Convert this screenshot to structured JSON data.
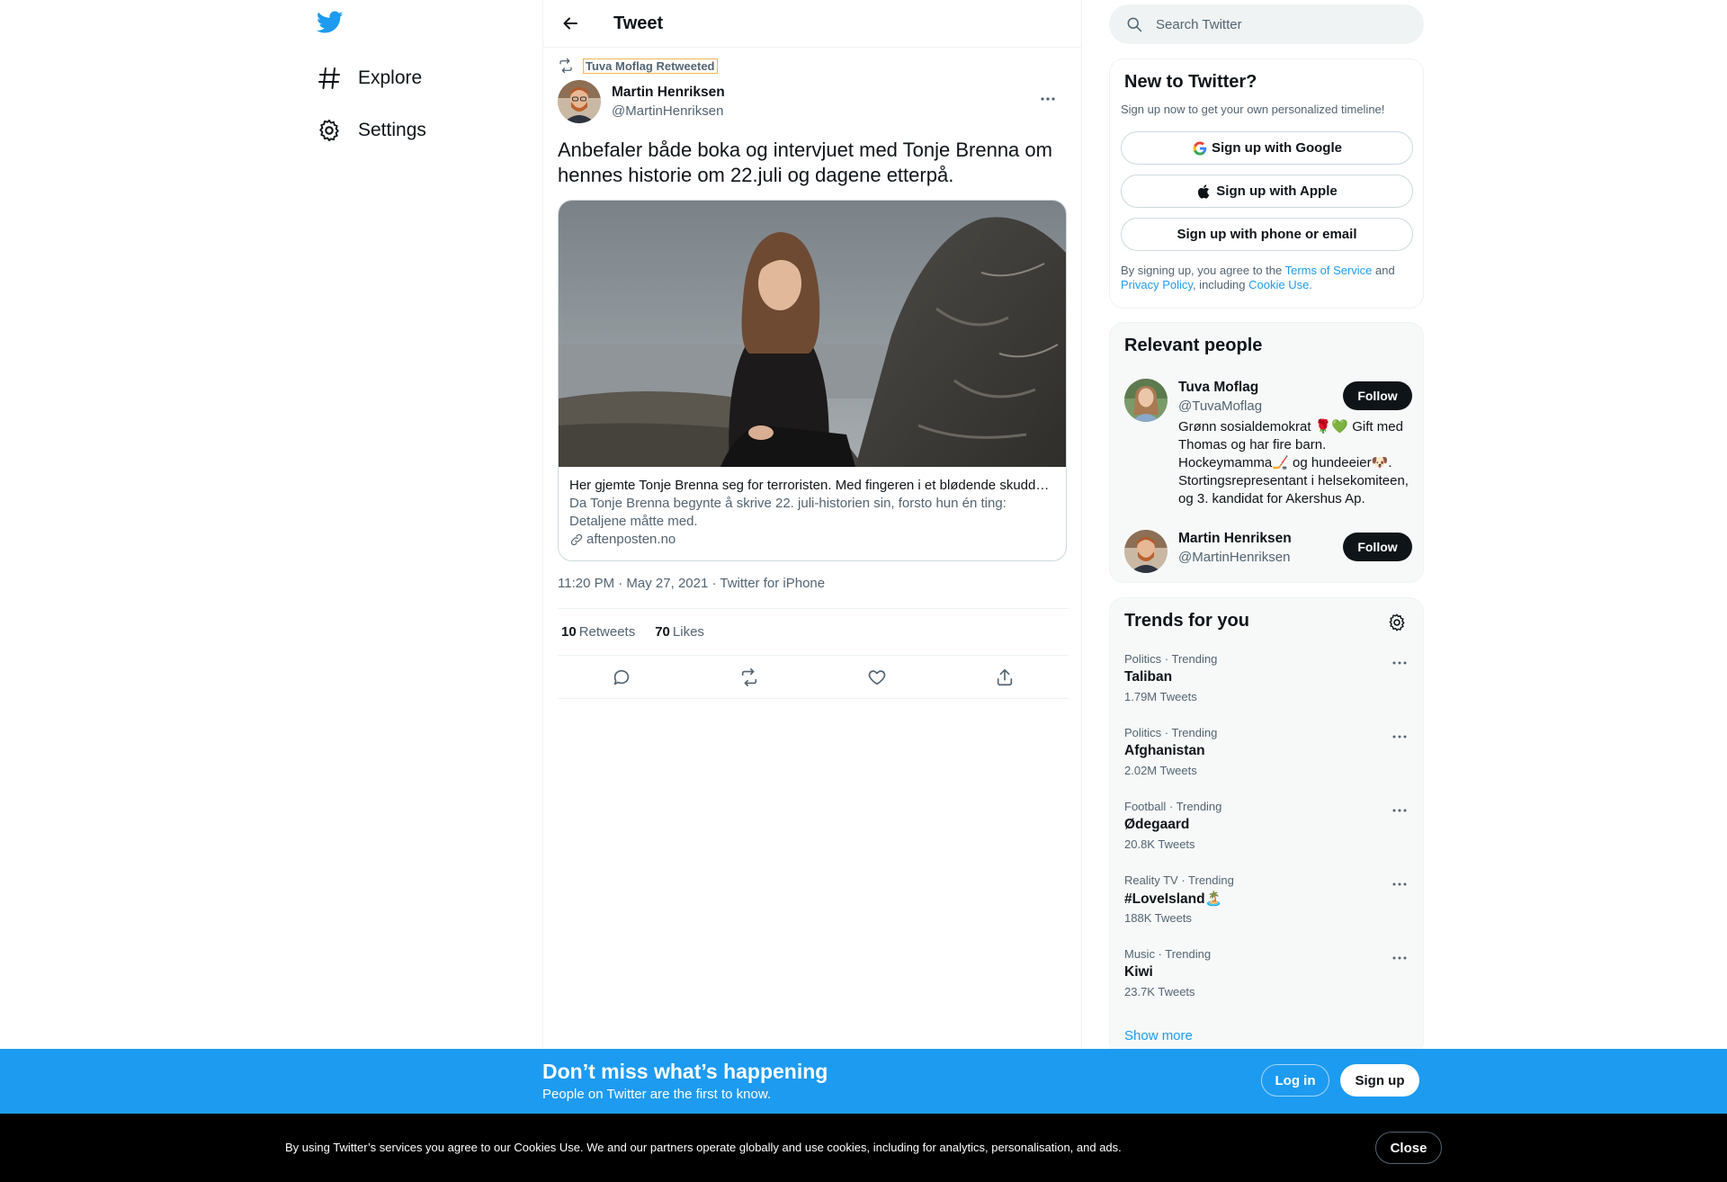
{
  "nav": {
    "items": [
      {
        "label": "Explore",
        "icon": "hashtag-icon"
      },
      {
        "label": "Settings",
        "icon": "gear-icon"
      }
    ]
  },
  "header": {
    "title": "Tweet"
  },
  "tweet": {
    "retweeted_by": "Tuva Moflag Retweeted",
    "author_name": "Martin Henriksen",
    "author_handle": "@MartinHenriksen",
    "text": "Anbefaler både boka og intervjuet med Tonje Brenna om hennes historie om 22.juli og dagene etterpå.",
    "card": {
      "title": "Her gjemte Tonje Brenna seg for terroristen. Med fingeren i et blødende skuddsår skrev hun et oppsiktsvekkende brev.",
      "description": "Da Tonje Brenna begynte å skrive 22. juli-historien sin, forsto hun én ting: Detaljene måtte med.",
      "domain": "aftenposten.no"
    },
    "meta": "11:20 PM · May 27, 2021 · Twitter for iPhone",
    "retweets_count": "10",
    "retweets_label": "Retweets",
    "likes_count": "70",
    "likes_label": "Likes"
  },
  "search": {
    "placeholder": "Search Twitter"
  },
  "new_to_twitter": {
    "title": "New to Twitter?",
    "subtitle": "Sign up now to get your own personalized timeline!",
    "google": "Sign up with Google",
    "apple": "Sign up with Apple",
    "phone": "Sign up with phone or email",
    "legal_1": "By signing up, you agree to the ",
    "terms": "Terms of Service",
    "legal_2": " and ",
    "privacy": "Privacy Policy",
    "legal_3": ", including ",
    "cookie": "Cookie Use."
  },
  "relevant": {
    "title": "Relevant people",
    "people": [
      {
        "name": "Tuva Moflag",
        "handle": "@TuvaMoflag",
        "bio": "Grønn sosialdemokrat 🌹💚 Gift med Thomas og har fire barn. Hockeymamma🏒 og hundeeier🐶. Stortingsrepresentant i helsekomiteen, og 3. kandidat for Akershus Ap.",
        "follow": "Follow"
      },
      {
        "name": "Martin Henriksen",
        "handle": "@MartinHenriksen",
        "bio": "",
        "follow": "Follow"
      }
    ]
  },
  "trends": {
    "title": "Trends for you",
    "items": [
      {
        "category": "Politics · Trending",
        "name": "Taliban",
        "count": "1.79M Tweets"
      },
      {
        "category": "Politics · Trending",
        "name": "Afghanistan",
        "count": "2.02M Tweets"
      },
      {
        "category": "Football · Trending",
        "name": "Ødegaard",
        "count": "20.8K Tweets"
      },
      {
        "category": "Reality TV · Trending",
        "name": "#LoveIsland🏝️",
        "count": "188K Tweets"
      },
      {
        "category": "Music · Trending",
        "name": "Kiwi",
        "count": "23.7K Tweets"
      }
    ],
    "show_more": "Show more"
  },
  "banner": {
    "title": "Don’t miss what’s happening",
    "subtitle": "People on Twitter are the first to know.",
    "login": "Log in",
    "signup": "Sign up"
  },
  "cookies": {
    "text": "By using Twitter’s services you agree to our Cookies Use. We and our partners operate globally and use cookies, including for analytics, personalisation, and ads.",
    "close": "Close"
  },
  "colors": {
    "accent": "#1d9bf0",
    "text": "#0f1419",
    "secondary": "#536471",
    "border": "#eff3f4"
  }
}
